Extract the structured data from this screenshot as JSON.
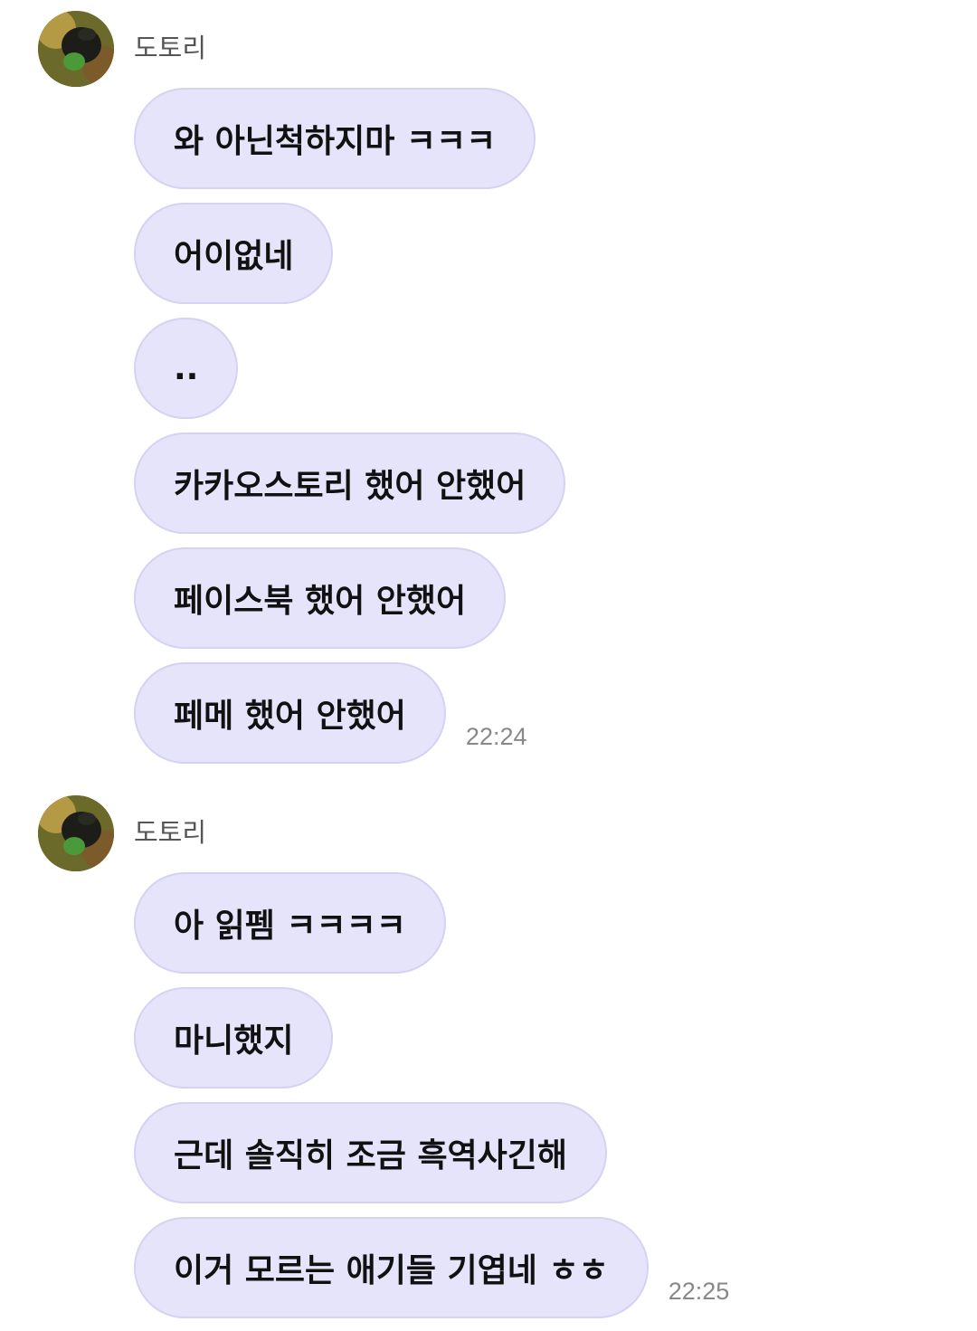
{
  "groups": [
    {
      "sender": "도토리",
      "avatar_icon": "profile-photo",
      "messages": [
        {
          "text": "와 아닌척하지마 ㅋㅋㅋ"
        },
        {
          "text": "어이없네"
        },
        {
          "text": ".."
        },
        {
          "text": "카카오스토리 했어 안했어"
        },
        {
          "text": "페이스북 했어 안했어"
        },
        {
          "text": "페메 했어 안했어",
          "time": "22:24"
        }
      ]
    },
    {
      "sender": "도토리",
      "avatar_icon": "profile-photo",
      "messages": [
        {
          "text": "아 읽펨 ㅋㅋㅋㅋ"
        },
        {
          "text": "마니했지"
        },
        {
          "text": "근데 솔직히 조금 흑역사긴해"
        },
        {
          "text": "이거 모르는 애기들 기엽네 ㅎㅎ",
          "time": "22:25"
        }
      ]
    }
  ],
  "colors": {
    "bubble": "#e6e4fa",
    "bubble_border": "#d5d2f2",
    "timestamp": "#888888",
    "sender": "#555555"
  }
}
